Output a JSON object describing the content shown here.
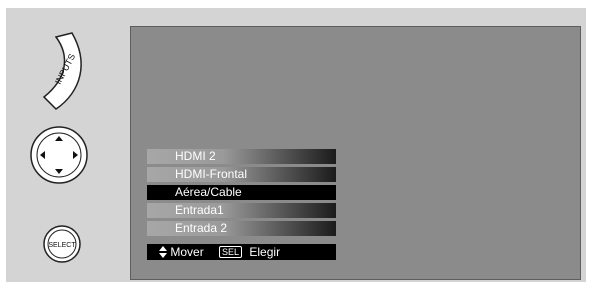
{
  "remote": {
    "inputs_label": "INPUTS",
    "select_label": "SELECT"
  },
  "menu": {
    "items": [
      {
        "label": "HDMI 2",
        "selected": false
      },
      {
        "label": "HDMI-Frontal",
        "selected": false
      },
      {
        "label": "Aérea/Cable",
        "selected": true
      },
      {
        "label": "Entrada1",
        "selected": false
      },
      {
        "label": "Entrada 2",
        "selected": false
      }
    ],
    "footer": {
      "move_label": "Mover",
      "sel_key": "SEL",
      "choose_label": "Elegir"
    }
  },
  "colors": {
    "frame": "#d4d4d4",
    "screen": "#8b8b8b",
    "menu_selected": "#000000",
    "menu_text": "#ffffff"
  },
  "icons": [
    "up-down-arrows-icon",
    "dpad-up-arrow-icon",
    "dpad-down-arrow-icon",
    "dpad-left-arrow-icon",
    "dpad-right-arrow-icon"
  ]
}
